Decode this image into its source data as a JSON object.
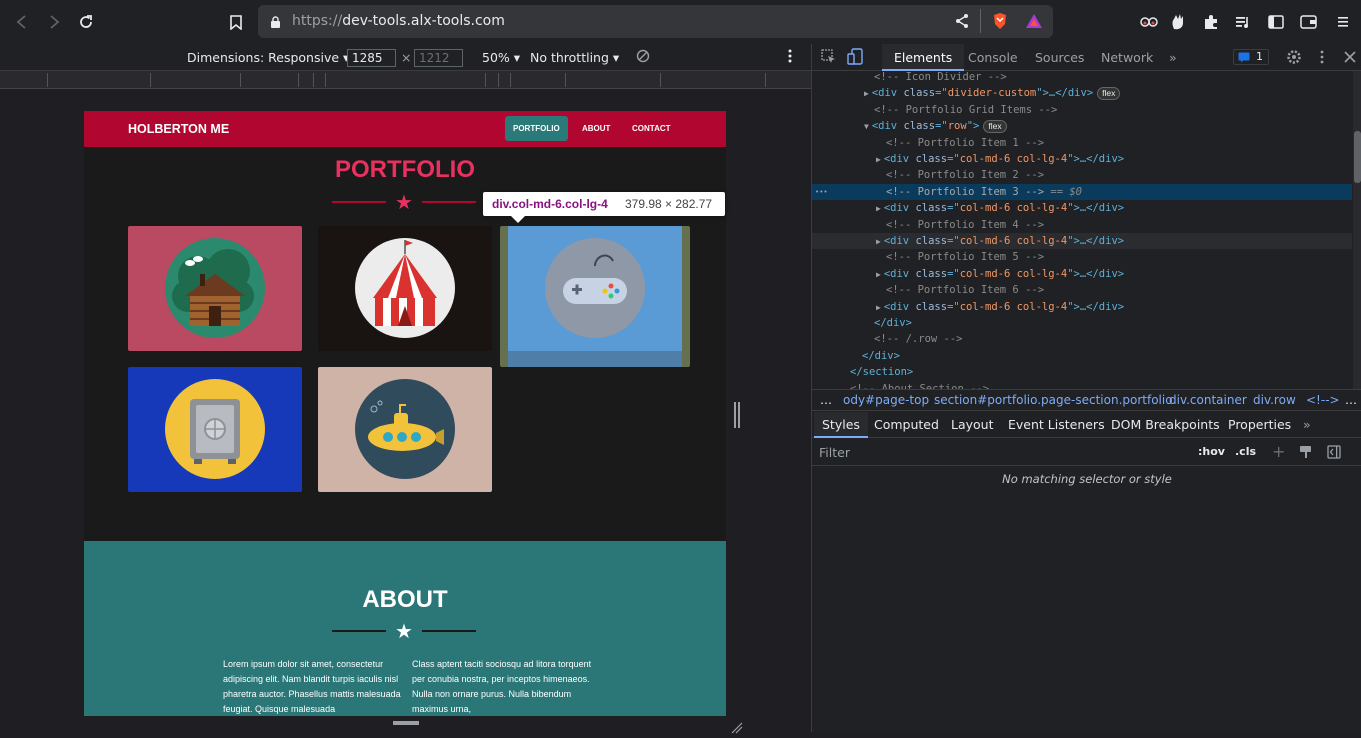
{
  "browser": {
    "url_scheme": "https://",
    "url_host": "dev-tools.alx-tools.com",
    "icons": [
      "back-arrow-icon",
      "forward-arrow-icon",
      "reload-icon",
      "bookmark-icon",
      "lock-icon",
      "share-icon",
      "brave-shield-icon",
      "brave-rewards-icon",
      "extension-icon",
      "puzzle-icon",
      "playlist-icon",
      "sidebar-icon",
      "wallet-icon",
      "menu-icon"
    ]
  },
  "device_toolbar": {
    "dimensions_label": "Dimensions: Responsive",
    "width_value": "1285",
    "times": "×",
    "height_placeholder": "1212",
    "zoom": "50%",
    "throttling": "No throttling"
  },
  "site": {
    "brand": "HOLBERTON ME",
    "nav": [
      "PORTFOLIO",
      "ABOUT",
      "CONTACT"
    ],
    "portfolio_title": "PORTFOLIO",
    "about_title": "ABOUT",
    "about_col1": "Lorem ipsum dolor sit amet, consectetur adipiscing elit. Nam blandit turpis iaculis nisl pharetra auctor. Phasellus mattis malesuada feugiat. Quisque malesuada",
    "about_col2": "Class aptent taciti sociosqu ad litora torquent per conubia nostra, per inceptos himenaeos. Nulla non ornare purus. Nulla bibendum maximus urna,",
    "colors": {
      "nav": "#b0062f",
      "title": "#e8315f",
      "about": "#2b7778"
    }
  },
  "tooltip": {
    "tag": "div.col-md-6.col-lg-4",
    "dims": "379.98 × 282.77"
  },
  "devtools": {
    "tabs": [
      "Elements",
      "Console",
      "Sources",
      "Network",
      "»"
    ],
    "issues_count": "1",
    "dom": [
      {
        "indent": 5,
        "text": "<!-- Icon Divider -->",
        "kind": "comment"
      },
      {
        "indent": 5,
        "arrow": "▶",
        "tag": "div",
        "attr": "class",
        "val": "divider-custom",
        "tail": "…</div>",
        "badge": "flex"
      },
      {
        "indent": 5,
        "text": "<!-- Portfolio Grid Items -->",
        "kind": "comment"
      },
      {
        "indent": 5,
        "arrow": "▼",
        "tag": "div",
        "attr": "class",
        "val": "row",
        "tail": "",
        "badge": "flex"
      },
      {
        "indent": 6,
        "text": "<!-- Portfolio Item 1 -->",
        "kind": "comment"
      },
      {
        "indent": 6,
        "arrow": "▶",
        "tag": "div",
        "attr": "class",
        "val": "col-md-6 col-lg-4",
        "tail": "…</div>"
      },
      {
        "indent": 6,
        "text": "<!-- Portfolio Item 2 -->",
        "kind": "comment"
      },
      {
        "indent": 6,
        "text": "<!-- Portfolio Item 3 -->",
        "kind": "comment",
        "selected": true,
        "suffix": " == $0"
      },
      {
        "indent": 6,
        "arrow": "▶",
        "tag": "div",
        "attr": "class",
        "val": "col-md-6 col-lg-4",
        "tail": "…</div>"
      },
      {
        "indent": 6,
        "text": "<!-- Portfolio Item 4 -->",
        "kind": "comment"
      },
      {
        "indent": 6,
        "arrow": "▶",
        "tag": "div",
        "attr": "class",
        "val": "col-md-6 col-lg-4",
        "tail": "…</div>",
        "hovered": true
      },
      {
        "indent": 6,
        "text": "<!-- Portfolio Item 5 -->",
        "kind": "comment"
      },
      {
        "indent": 6,
        "arrow": "▶",
        "tag": "div",
        "attr": "class",
        "val": "col-md-6 col-lg-4",
        "tail": "…</div>"
      },
      {
        "indent": 6,
        "text": "<!-- Portfolio Item 6 -->",
        "kind": "comment"
      },
      {
        "indent": 6,
        "arrow": "▶",
        "tag": "div",
        "attr": "class",
        "val": "col-md-6 col-lg-4",
        "tail": "…</div>"
      },
      {
        "indent": 5,
        "text": "</div>",
        "kind": "close"
      },
      {
        "indent": 5,
        "text": "<!-- /.row -->",
        "kind": "comment"
      },
      {
        "indent": 4,
        "text": "</div>",
        "kind": "close"
      },
      {
        "indent": 3,
        "text": "</section>",
        "kind": "close"
      },
      {
        "indent": 3,
        "text": "<!-- About Section -->",
        "kind": "comment"
      }
    ],
    "breadcrumbs": [
      "…",
      "ody#page-top",
      "section#portfolio.page-section.portfolio",
      "div.container",
      "div.row",
      "<!-->"
    ],
    "styles_tabs": [
      "Styles",
      "Computed",
      "Layout",
      "Event Listeners",
      "DOM Breakpoints",
      "Properties",
      "»"
    ],
    "filter_placeholder": "Filter",
    "hov": ":hov",
    "cls": ".cls",
    "no_match": "No matching selector or style"
  }
}
